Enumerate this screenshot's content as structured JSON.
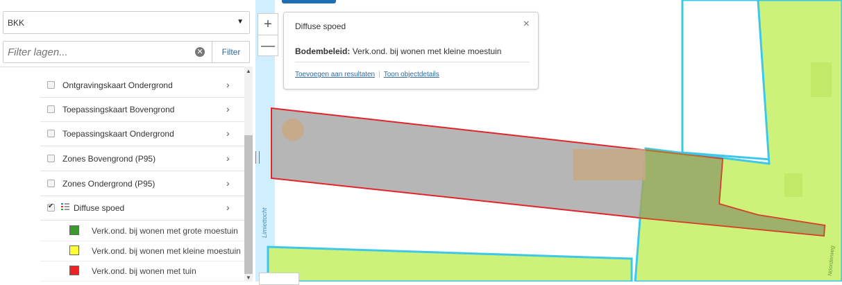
{
  "sidebar": {
    "base_map_select": "BKK",
    "filter": {
      "placeholder": "Filter lagen...",
      "button_label": "Filter"
    },
    "layers": [
      {
        "label": "Ontgravingskaart Ondergrond",
        "checked": false
      },
      {
        "label": "Toepassingskaart Bovengrond",
        "checked": false
      },
      {
        "label": "Toepassingskaart Ondergrond",
        "checked": false
      },
      {
        "label": "Zones Bovengrond (P95)",
        "checked": false
      },
      {
        "label": "Zones Ondergrond (P95)",
        "checked": false
      },
      {
        "label": "Diffuse spoed",
        "checked": true
      }
    ],
    "legend": [
      {
        "label": "Verk.ond. bij wonen met grote moestuin",
        "color": "#3a9a2e"
      },
      {
        "label": "Verk.ond. bij wonen met kleine moestuin",
        "color": "#ffff33"
      },
      {
        "label": "Verk.ond. bij wonen met tuin",
        "color": "#ee2222"
      }
    ]
  },
  "map": {
    "zoom_in": "+",
    "zoom_out": "—",
    "water_label": "Limiettocht",
    "road_label": "Noorderweg",
    "colors": {
      "water": "#cfefff",
      "water_border": "#3fc7e8",
      "parcel_fill": "#ccf27a",
      "highlight_fill": "#a9a9a9",
      "highlight_border": "#e3232a",
      "field": "#ffffff"
    }
  },
  "popup": {
    "title": "Diffuse spoed",
    "close": "×",
    "field_label": "Bodembeleid:",
    "field_value": "Verk.ond. bij wonen met kleine moestuin",
    "link_add": "Toevoegen aan resultaten",
    "link_details": "Toon objectdetails"
  }
}
